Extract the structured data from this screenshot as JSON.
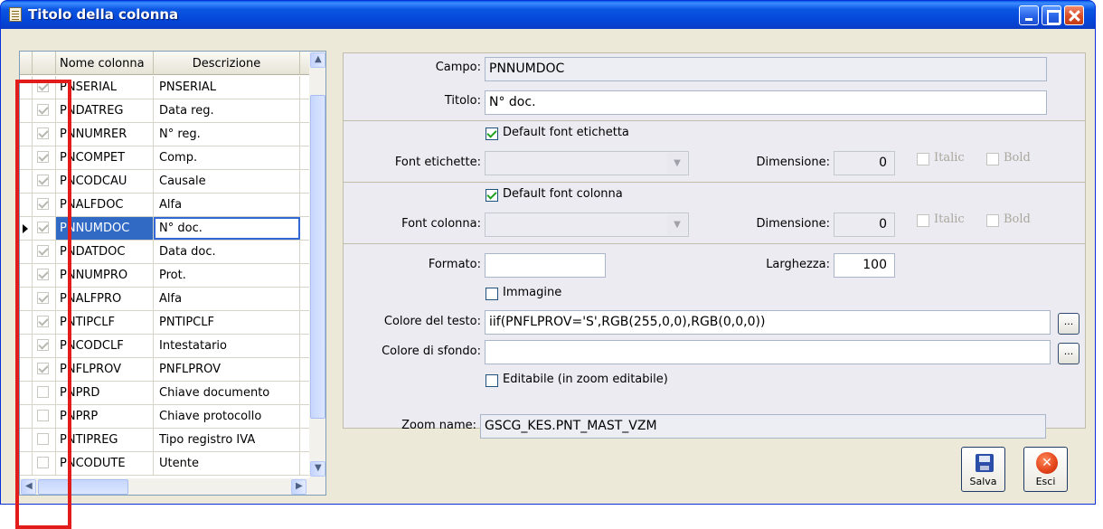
{
  "window": {
    "title": "Titolo della colonna"
  },
  "grid": {
    "headers": {
      "name": "Nome colonna",
      "description": "Descrizione"
    },
    "rows": [
      {
        "name": "PNSERIAL",
        "desc": "PNSERIAL",
        "checked": true
      },
      {
        "name": "PNDATREG",
        "desc": "Data reg.",
        "checked": true
      },
      {
        "name": "PNNUMRER",
        "desc": "N° reg.",
        "checked": true
      },
      {
        "name": "PNCOMPET",
        "desc": "Comp.",
        "checked": true
      },
      {
        "name": "PNCODCAU",
        "desc": "Causale",
        "checked": true
      },
      {
        "name": "PNALFDOC",
        "desc": "Alfa",
        "checked": true
      },
      {
        "name": "PNNUMDOC",
        "desc": "N° doc.",
        "checked": true,
        "current": true
      },
      {
        "name": "PNDATDOC",
        "desc": "Data doc.",
        "checked": true
      },
      {
        "name": "PNNUMPRO",
        "desc": "Prot.",
        "checked": true
      },
      {
        "name": "PNALFPRO",
        "desc": "Alfa",
        "checked": true
      },
      {
        "name": "PNTIPCLF",
        "desc": "PNTIPCLF",
        "checked": true
      },
      {
        "name": "PNCODCLF",
        "desc": "Intestatario",
        "checked": true
      },
      {
        "name": "PNFLPROV",
        "desc": "PNFLPROV",
        "checked": true
      },
      {
        "name": "PNPRD",
        "desc": "Chiave documento",
        "checked": false
      },
      {
        "name": "PNPRP",
        "desc": "Chiave protocollo",
        "checked": false
      },
      {
        "name": "PNTIPREG",
        "desc": "Tipo registro IVA",
        "checked": false
      },
      {
        "name": "PNCODUTE",
        "desc": "Utente",
        "checked": false
      }
    ]
  },
  "form": {
    "campo_label": "Campo:",
    "campo_value": "PNNUMDOC",
    "titolo_label": "Titolo:",
    "titolo_value": "N° doc.",
    "default_font_etichetta": "Default font etichetta",
    "font_etichette_label": "Font etichette:",
    "dimensione_label": "Dimensione:",
    "dimensione_etichette_value": "0",
    "italic_label": "Italic",
    "bold_label": "Bold",
    "default_font_colonna": "Default font colonna",
    "font_colonna_label": "Font colonna:",
    "dimensione_colonna_value": "0",
    "formato_label": "Formato:",
    "formato_value": "",
    "larghezza_label": "Larghezza:",
    "larghezza_value": "100",
    "immagine_label": "Immagine",
    "colore_testo_label": "Colore del testo:",
    "colore_testo_value": "iif(PNFLPROV='S',RGB(255,0,0),RGB(0,0,0))",
    "colore_sfondo_label": "Colore di sfondo:",
    "colore_sfondo_value": "",
    "editabile_label": "Editabile (in zoom editabile)",
    "dots_label": "...",
    "zoom_name_label": "Zoom name:",
    "zoom_name_value": "GSCG_KES.PNT_MAST_VZM"
  },
  "buttons": {
    "salva": "Salva",
    "esci": "Esci"
  },
  "colors": {
    "highlight_box": "#e21b1b",
    "selection": "#316ac5"
  }
}
